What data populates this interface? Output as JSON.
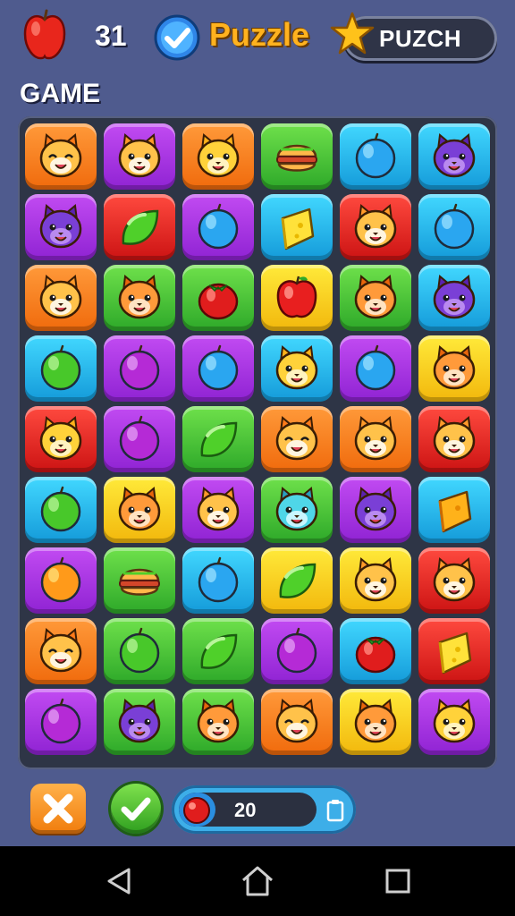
{
  "header": {
    "score": "31",
    "title": "Puzzle",
    "pill_label": "PUZCH",
    "icons": [
      "apple-icon",
      "check-badge-icon",
      "star-icon"
    ]
  },
  "section_label": "GAME",
  "board": {
    "rows": [
      [
        {
          "color": "orange",
          "piece": "cat-happy"
        },
        {
          "color": "purple",
          "piece": "cat"
        },
        {
          "color": "orange",
          "piece": "cat-yellow"
        },
        {
          "color": "green",
          "piece": "burger"
        },
        {
          "color": "cyan",
          "piece": "berry-blue"
        },
        {
          "color": "cyan",
          "piece": "cat-purple"
        }
      ],
      [
        {
          "color": "purple",
          "piece": "cat-purple"
        },
        {
          "color": "red",
          "piece": "leaf-green"
        },
        {
          "color": "purple",
          "piece": "berry-blue"
        },
        {
          "color": "cyan",
          "piece": "cheese"
        },
        {
          "color": "red",
          "piece": "cat"
        },
        {
          "color": "cyan",
          "piece": "berry-blue"
        }
      ],
      [
        {
          "color": "orange",
          "piece": "cat"
        },
        {
          "color": "green",
          "piece": "cat-orange"
        },
        {
          "color": "green",
          "piece": "tomato"
        },
        {
          "color": "yellow",
          "piece": "apple-red"
        },
        {
          "color": "green",
          "piece": "cat-orange"
        },
        {
          "color": "cyan",
          "piece": "cat-purple"
        }
      ],
      [
        {
          "color": "cyan",
          "piece": "lime"
        },
        {
          "color": "purple",
          "piece": "plum"
        },
        {
          "color": "purple",
          "piece": "berry-blue"
        },
        {
          "color": "cyan",
          "piece": "cat-yellow"
        },
        {
          "color": "purple",
          "piece": "berry-blue"
        },
        {
          "color": "yellow",
          "piece": "cat-orange"
        }
      ],
      [
        {
          "color": "red",
          "piece": "cat-yellow"
        },
        {
          "color": "purple",
          "piece": "plum"
        },
        {
          "color": "green",
          "piece": "leaf-green"
        },
        {
          "color": "orange",
          "piece": "cat-happy"
        },
        {
          "color": "orange",
          "piece": "cat"
        },
        {
          "color": "red",
          "piece": "cat"
        }
      ],
      [
        {
          "color": "cyan",
          "piece": "lime"
        },
        {
          "color": "yellow",
          "piece": "cat-orange"
        },
        {
          "color": "purple",
          "piece": "cat"
        },
        {
          "color": "green",
          "piece": "cat-cyan"
        },
        {
          "color": "purple",
          "piece": "cat-purple"
        },
        {
          "color": "cyan",
          "piece": "cheese-orange"
        }
      ],
      [
        {
          "color": "purple",
          "piece": "orange-fruit"
        },
        {
          "color": "green",
          "piece": "burger"
        },
        {
          "color": "cyan",
          "piece": "berry-blue"
        },
        {
          "color": "yellow",
          "piece": "leaf-green"
        },
        {
          "color": "yellow",
          "piece": "cat"
        },
        {
          "color": "red",
          "piece": "cat"
        }
      ],
      [
        {
          "color": "orange",
          "piece": "cat-happy"
        },
        {
          "color": "green",
          "piece": "lime"
        },
        {
          "color": "green",
          "piece": "leaf-green"
        },
        {
          "color": "purple",
          "piece": "plum"
        },
        {
          "color": "cyan",
          "piece": "tomato"
        },
        {
          "color": "red",
          "piece": "cheese"
        }
      ],
      [
        {
          "color": "purple",
          "piece": "plum"
        },
        {
          "color": "green",
          "piece": "cat-purple"
        },
        {
          "color": "green",
          "piece": "cat-orange"
        },
        {
          "color": "orange",
          "piece": "cat-happy"
        },
        {
          "color": "yellow",
          "piece": "cat-orange"
        },
        {
          "color": "purple",
          "piece": "cat-yellow"
        }
      ]
    ]
  },
  "footer": {
    "progress_value": "20",
    "progress_fraction": 0.2,
    "icons": [
      "close-icon",
      "check-icon",
      "ball-icon",
      "clipboard-icon"
    ]
  },
  "navigation": {
    "icons": [
      "back-icon",
      "home-icon",
      "recent-apps-icon"
    ]
  },
  "colors": {
    "background": "#4f5b8e",
    "title": "#ffb21f",
    "board": "#2e3546"
  }
}
